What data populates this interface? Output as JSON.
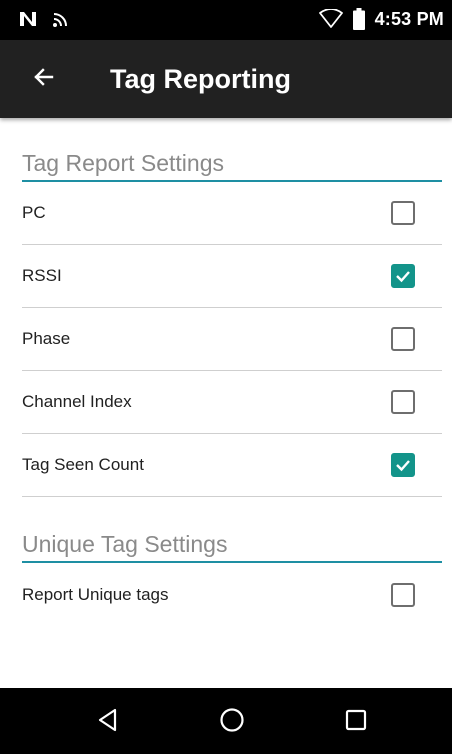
{
  "status_bar": {
    "time": "4:53 PM",
    "left_icons": [
      "nfc-icon",
      "cast-icon"
    ],
    "right_icons": [
      "wifi-icon",
      "battery-icon"
    ]
  },
  "app_bar": {
    "title": "Tag Reporting",
    "back_icon": "arrow-left-icon"
  },
  "sections": {
    "tag_report": {
      "header": "Tag Report Settings",
      "items": [
        {
          "label": "PC",
          "checked": false
        },
        {
          "label": "RSSI",
          "checked": true
        },
        {
          "label": "Phase",
          "checked": false
        },
        {
          "label": "Channel Index",
          "checked": false
        },
        {
          "label": "Tag Seen Count",
          "checked": true
        }
      ]
    },
    "unique_tag": {
      "header": "Unique Tag Settings",
      "items": [
        {
          "label": "Report Unique tags",
          "checked": false
        }
      ]
    }
  },
  "nav_bar": {
    "icons": [
      "back-triangle-icon",
      "home-circle-icon",
      "recents-square-icon"
    ]
  },
  "colors": {
    "accent": "#13948a",
    "section_line": "#1e8fa3",
    "app_bar": "#212121",
    "status_bar": "#000000"
  }
}
